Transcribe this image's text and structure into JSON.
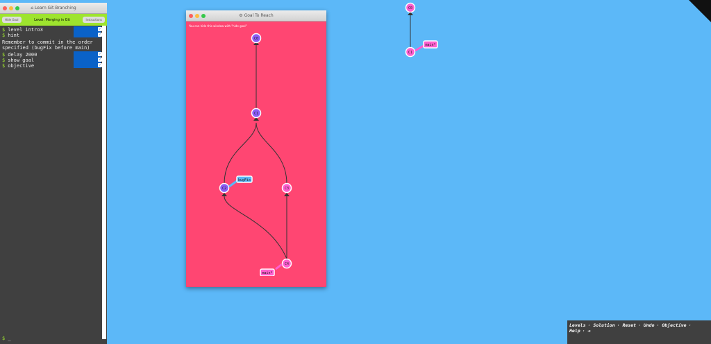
{
  "left_window": {
    "title": "Learn Git Branching",
    "hide_goal": "Hide Goal",
    "level_label": "Level: Merging in Git",
    "objective_btn": "Instructions"
  },
  "terminal": {
    "commands1": [
      "level intro3",
      "hint"
    ],
    "message": "Remember to commit in the order specified (bugFix before main)",
    "commands2": [
      "delay 2000",
      "show goal",
      "objective"
    ],
    "prompt": "$"
  },
  "goal_window": {
    "title": "Goal To Reach",
    "hint": "You can hide this window with \"hide goal\"",
    "nodes": [
      "C0",
      "C1",
      "C2",
      "C3",
      "C4"
    ],
    "branches": [
      "bugFix",
      "main*"
    ]
  },
  "main_tree": {
    "nodes": [
      "C0",
      "C1"
    ],
    "branch": "main*"
  },
  "bottom_menu": [
    "Levels",
    "Solution",
    "Reset",
    "Undo",
    "Objective",
    "Help"
  ],
  "colors": {
    "background": "#5cb8f8",
    "goal": "#ff4672",
    "node_purple": "#8c5cf6",
    "node_pink": "#ff5fd0"
  }
}
